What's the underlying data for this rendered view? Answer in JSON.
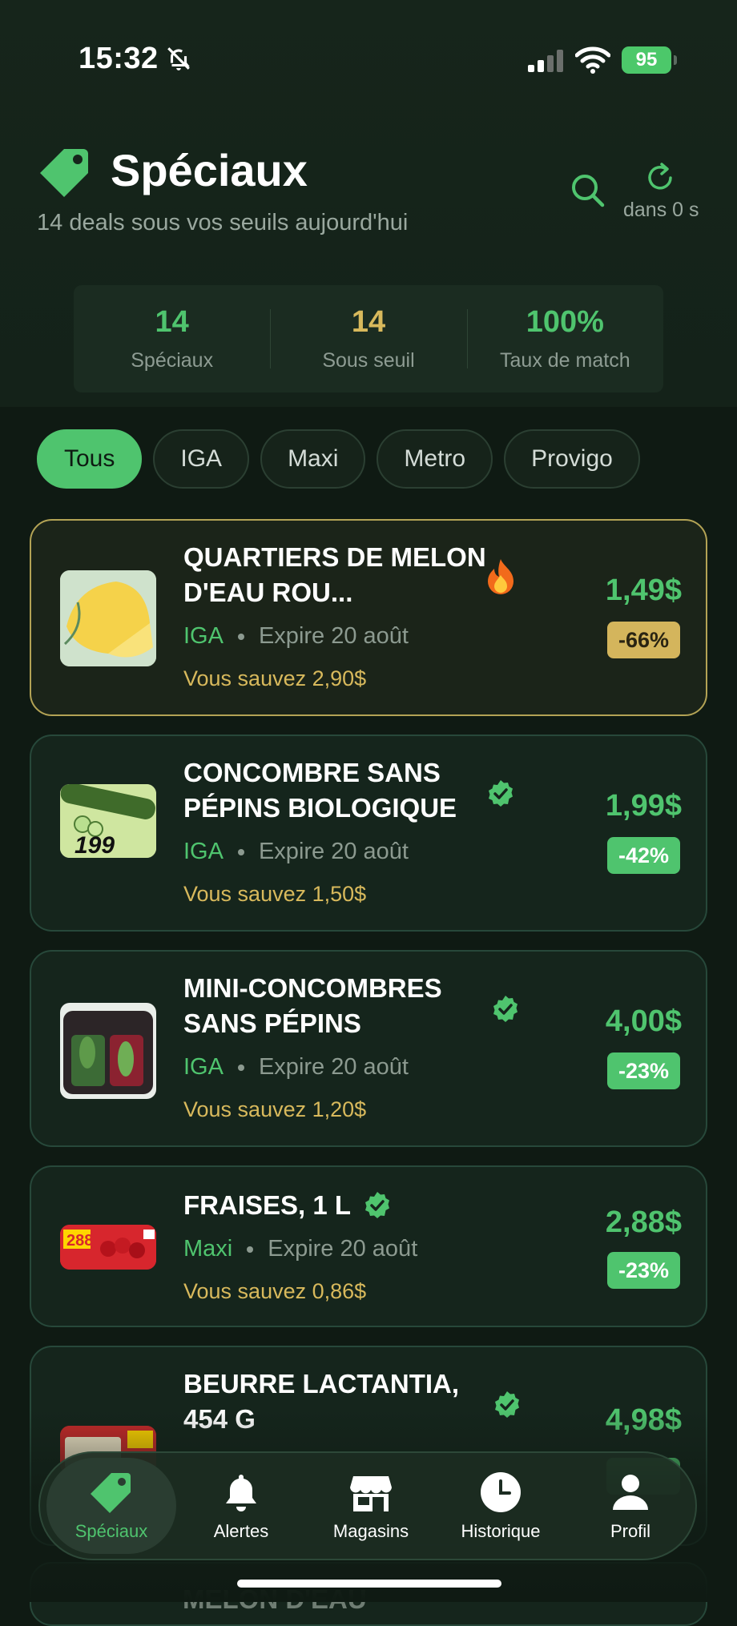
{
  "status": {
    "time": "15:32",
    "battery": "95"
  },
  "header": {
    "title": "Spéciaux",
    "subtitle": "14 deals sous vos seuils aujourd'hui",
    "refresh_label": "dans 0 s"
  },
  "stats": [
    {
      "value": "14",
      "label": "Spéciaux",
      "color": "#4fc46e"
    },
    {
      "value": "14",
      "label": "Sous seuil",
      "color": "#d8b95c"
    },
    {
      "value": "100%",
      "label": "Taux de match",
      "color": "#4fc46e"
    }
  ],
  "filters": [
    "Tous",
    "IGA",
    "Maxi",
    "Metro",
    "Provigo"
  ],
  "active_filter": "Tous",
  "deals": [
    {
      "name": "QUARTIERS DE MELON D'EAU ROU...",
      "store": "IGA",
      "expiry": "Expire 20 août",
      "savings": "Vous sauvez 2,90$",
      "price": "1,49$",
      "discount": "-66%",
      "badge": "fire-icon"
    },
    {
      "name": "CONCOMBRE SANS PÉPINS BIOLOGIQUE",
      "store": "IGA",
      "expiry": "Expire 20 août",
      "savings": "Vous sauvez 1,50$",
      "price": "1,99$",
      "discount": "-42%",
      "badge": "verified-icon"
    },
    {
      "name": "MINI-CONCOMBRES SANS PÉPINS",
      "store": "IGA",
      "expiry": "Expire 20 août",
      "savings": "Vous sauvez 1,20$",
      "price": "4,00$",
      "discount": "-23%",
      "badge": "verified-icon"
    },
    {
      "name": "FRAISES, 1 L",
      "store": "Maxi",
      "expiry": "Expire 20 août",
      "savings": "Vous sauvez 0,86$",
      "price": "2,88$",
      "discount": "-23%",
      "badge": "verified-icon"
    },
    {
      "name": "BEURRE LACTANTIA, 454 G",
      "price": "4,98$",
      "badge": "verified-icon"
    }
  ],
  "peek_text": "MELON D'EAU",
  "nav": [
    "Spéciaux",
    "Alertes",
    "Magasins",
    "Historique",
    "Profil"
  ],
  "colors": {
    "accent": "#4fc46e",
    "gold": "#d8b95c",
    "background": "#0f1a13"
  }
}
